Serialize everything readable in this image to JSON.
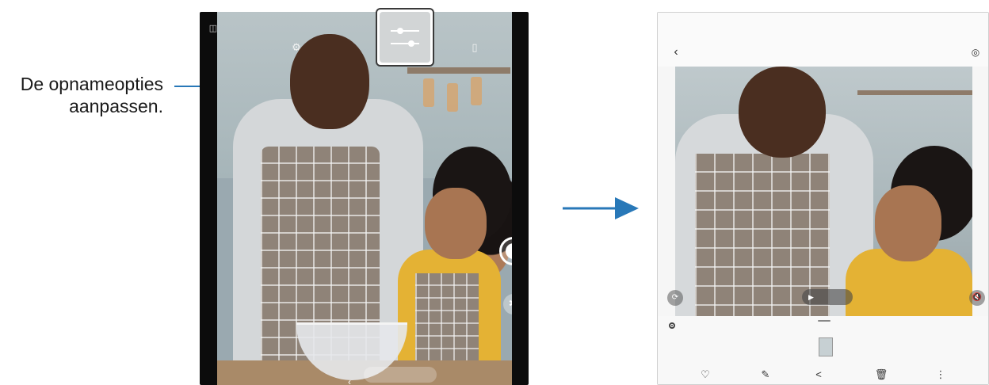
{
  "callout": {
    "line1": "De opnameopties",
    "line2": "aanpassen."
  },
  "camera_screen": {
    "icons": {
      "layout": "layout-icon",
      "settings": "settings-icon",
      "options": "sliders-icon",
      "ratio": "aspect-ratio-icon",
      "shutter": "shutter-icon",
      "effects": "effects-icon",
      "back": "back-icon"
    },
    "glyphs": {
      "layout": "◫",
      "settings": "⚙",
      "ratio": "▯",
      "effects": "✱",
      "back": "‹"
    }
  },
  "gallery_screen": {
    "glyphs": {
      "back": "‹",
      "remaster": "◎",
      "rotate": "⟳",
      "mute": "🔇",
      "play": "▶",
      "favorite": "♡",
      "edit": "✎",
      "share": "<",
      "delete": "🗑",
      "more": "⋮"
    },
    "icons": {
      "back": "back-icon",
      "remaster": "remaster-icon",
      "rotate": "rotate-icon",
      "mute": "mute-icon",
      "play": "play-icon",
      "favorite": "heart-icon",
      "edit": "pencil-icon",
      "share": "share-icon",
      "delete": "trash-icon",
      "more": "more-icon"
    }
  },
  "colors": {
    "accent": "#2878b8",
    "callout_text": "#1a1a1a"
  }
}
